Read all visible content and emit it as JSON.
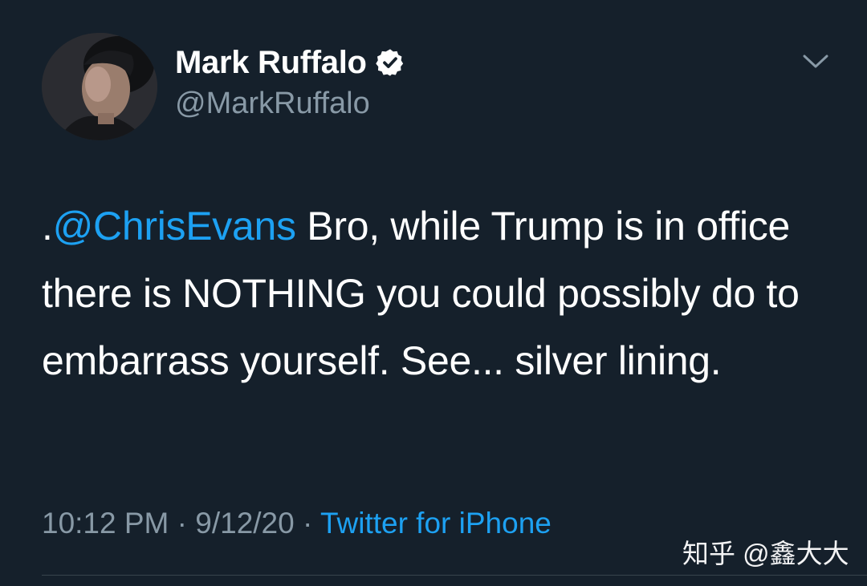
{
  "author": {
    "display_name": "Mark Ruffalo",
    "handle": "@MarkRuffalo",
    "verified": true,
    "avatar_icon": "profile-photo"
  },
  "tweet": {
    "prefix": ".",
    "mention": "@ChrisEvans",
    "body": " Bro, while Trump is in office there is NOTHING you could possibly do to embarrass yourself. See... silver lining."
  },
  "meta": {
    "time": "10:12 PM",
    "separator": " · ",
    "date": "9/12/20",
    "source": "Twitter for iPhone"
  },
  "watermark": "知乎 @鑫大大",
  "colors": {
    "background": "#15202b",
    "text_primary": "#ffffff",
    "text_secondary": "#8899a6",
    "accent": "#1da1f2",
    "divider": "#38444d"
  },
  "icons": {
    "verified": "verified-badge-icon",
    "more": "chevron-down-icon"
  }
}
